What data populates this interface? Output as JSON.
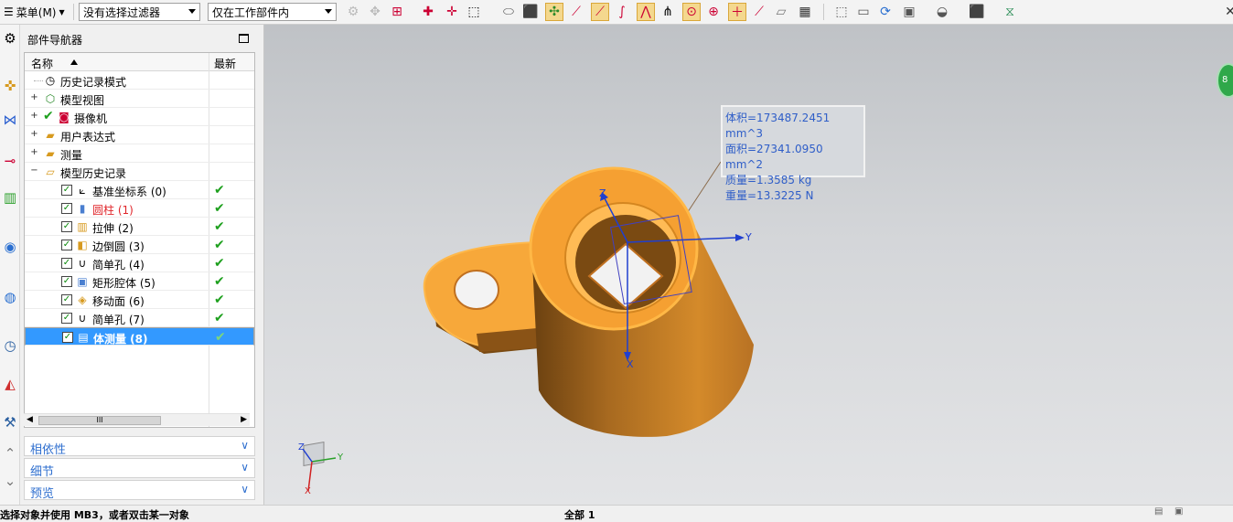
{
  "toolbar": {
    "menu_label": "菜单(M)",
    "filter_value": "没有选择过滤器",
    "scope_value": "仅在工作部件内"
  },
  "navigator": {
    "title": "部件导航器",
    "col_name": "名称",
    "col_latest": "最新",
    "rows": [
      {
        "label": "历史记录模式"
      },
      {
        "label": "模型视图"
      },
      {
        "label": "摄像机"
      },
      {
        "label": "用户表达式"
      },
      {
        "label": "测量"
      },
      {
        "label": "模型历史记录"
      },
      {
        "label": "基准坐标系 (0)"
      },
      {
        "label": "圆柱 (1)"
      },
      {
        "label": "拉伸 (2)"
      },
      {
        "label": "边倒圆 (3)"
      },
      {
        "label": "简单孔 (4)"
      },
      {
        "label": "矩形腔体 (5)"
      },
      {
        "label": "移动面 (6)"
      },
      {
        "label": "简单孔 (7)"
      },
      {
        "label": "体测量 (8)"
      }
    ],
    "hscroll_label": "III",
    "panels": {
      "dependencies": "相依性",
      "details": "细节",
      "preview": "预览"
    }
  },
  "measurement": {
    "volume": "体积=173487.2451 mm^3",
    "area": "面积=27341.0950 mm^2",
    "mass": "质量=1.3585 kg",
    "weight": "重量=13.3225 N"
  },
  "viewport": {
    "axis_x": "X",
    "axis_y": "Y",
    "axis_z": "Z",
    "triad_x": "X",
    "triad_y": "Y",
    "triad_z": "Z",
    "badge": "8"
  },
  "status": {
    "left": "选择对象并使用 MB3，或者双击某一对象",
    "middle": "全部 1"
  },
  "colors": {
    "part": "#f2a43c",
    "part_edge": "#ffb046",
    "highlight": "#3399ff"
  }
}
